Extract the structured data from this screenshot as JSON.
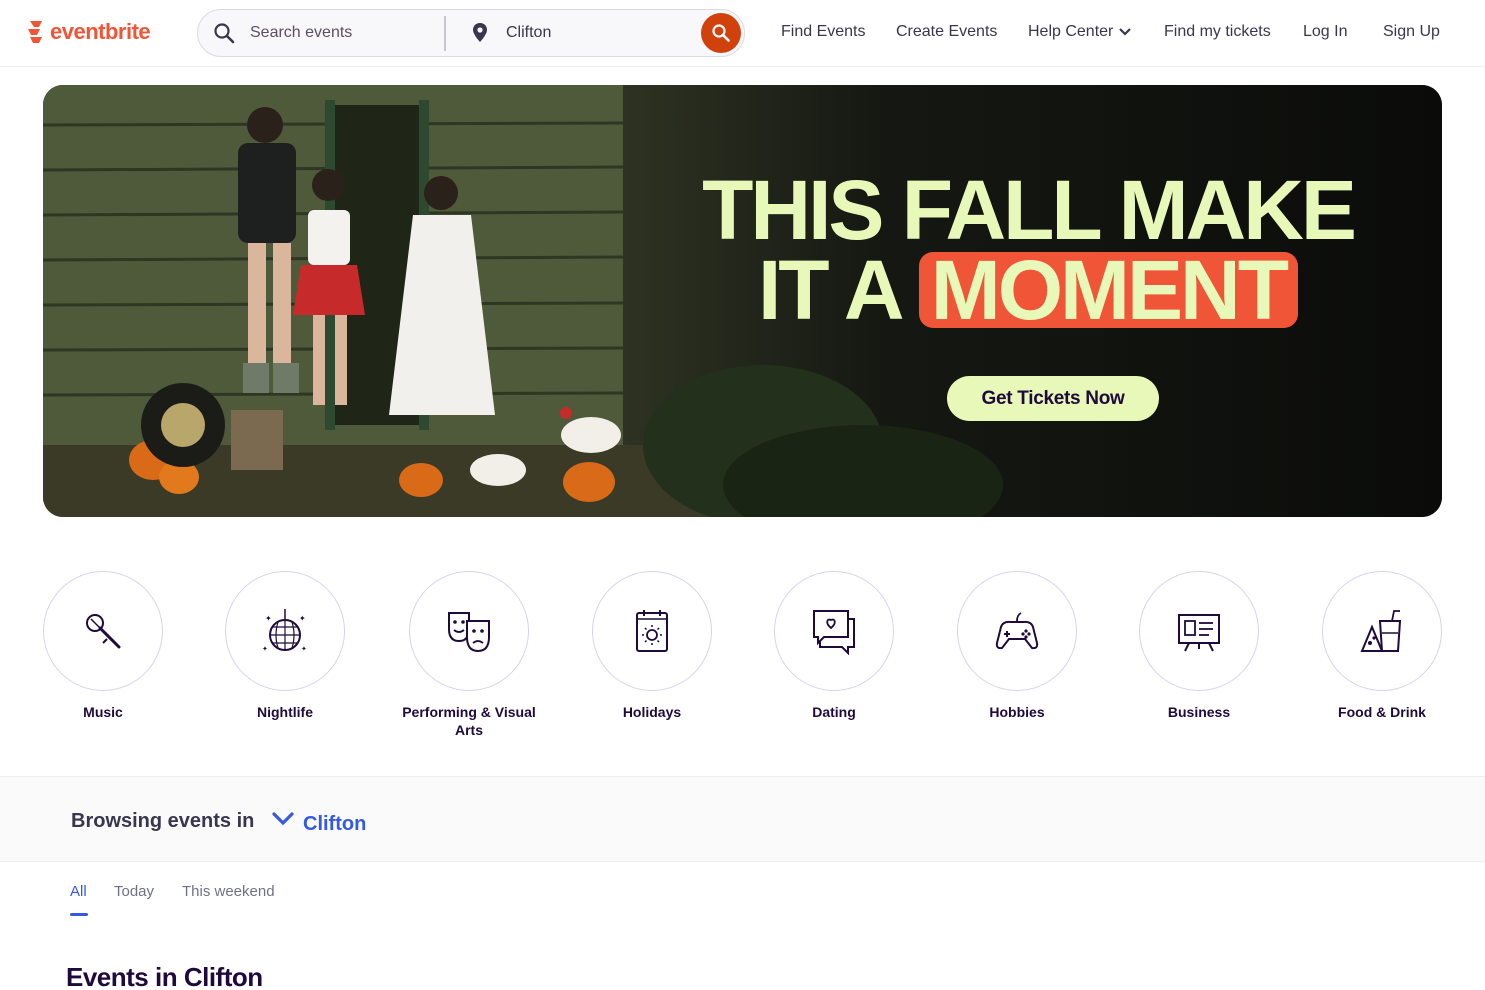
{
  "brand": {
    "name": "eventbrite",
    "color": "#f05537"
  },
  "search": {
    "placeholder": "Search events",
    "location_value": "Clifton",
    "button_color": "#d1410c"
  },
  "nav": {
    "find_events": "Find Events",
    "create_events": "Create Events",
    "help_center": "Help Center",
    "find_tickets": "Find my tickets",
    "log_in": "Log In",
    "sign_up": "Sign Up"
  },
  "hero": {
    "line1": "THIS FALL MAKE",
    "line2_prefix": "IT A ",
    "line2_highlight": "MOMENT",
    "cta": "Get Tickets Now",
    "text_color": "#e8f8b8",
    "highlight_color": "#f05537"
  },
  "categories": [
    {
      "label": "Music",
      "icon": "microphone-icon"
    },
    {
      "label": "Nightlife",
      "icon": "disco-ball-icon"
    },
    {
      "label": "Performing & Visual Arts",
      "icon": "theater-masks-icon"
    },
    {
      "label": "Holidays",
      "icon": "calendar-sun-icon"
    },
    {
      "label": "Dating",
      "icon": "chat-heart-icon"
    },
    {
      "label": "Hobbies",
      "icon": "gamepad-icon"
    },
    {
      "label": "Business",
      "icon": "presentation-board-icon"
    },
    {
      "label": "Food & Drink",
      "icon": "food-drink-icon"
    }
  ],
  "browse": {
    "label": "Browsing events in",
    "city": "Clifton",
    "accent": "#3659e3"
  },
  "tabs": [
    {
      "label": "All",
      "active": true
    },
    {
      "label": "Today",
      "active": false
    },
    {
      "label": "This weekend",
      "active": false
    }
  ],
  "events": {
    "heading": "Events in Clifton"
  }
}
